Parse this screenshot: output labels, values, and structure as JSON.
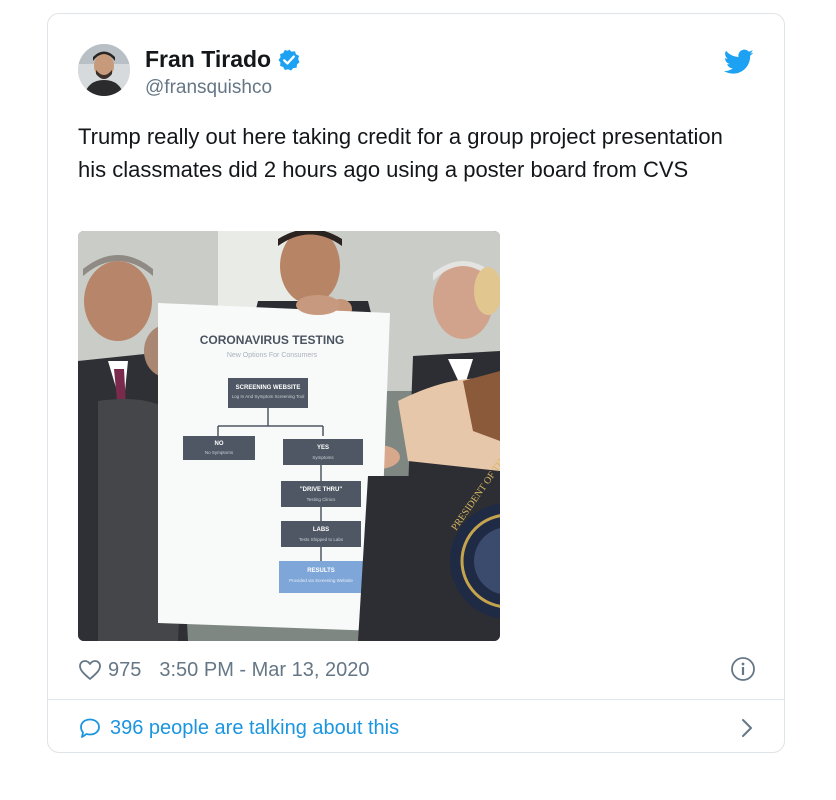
{
  "author": {
    "name": "Fran Tirado",
    "handle": "@fransquishco",
    "verified_icon": "verified-badge-icon"
  },
  "brand_icon": "twitter-bird-icon",
  "tweet": {
    "text": "Trump really out here taking credit for a group project presentation his classmates did 2 hours ago using a poster board from CVS"
  },
  "media": {
    "poster_title": "CORONAVIRUS TESTING",
    "poster_subtitle": "New Options For Consumers",
    "boxes": {
      "screening": "SCREENING WEBSITE",
      "screening_sub": "Log In And Symptom Screening Tool",
      "no": "NO",
      "no_sub": "No Symptoms",
      "yes": "YES",
      "yes_sub": "Symptoms",
      "drive": "\"DRIVE THRU\"",
      "drive_sub": "Testing Clinics",
      "labs": "LABS",
      "labs_sub": "Tests Shipped to Labs",
      "results": "RESULTS",
      "results_sub": "Provided via Screening Website"
    },
    "seal_text": "PRESIDENT OF THE UNITED STATES"
  },
  "meta": {
    "likes": "975",
    "timestamp": "3:50 PM - Mar 13, 2020"
  },
  "footer": {
    "talking": "396 people are talking about this"
  },
  "colors": {
    "link_blue": "#1b95e0",
    "twitter_blue": "#1da1f2",
    "secondary_text": "#657786"
  }
}
